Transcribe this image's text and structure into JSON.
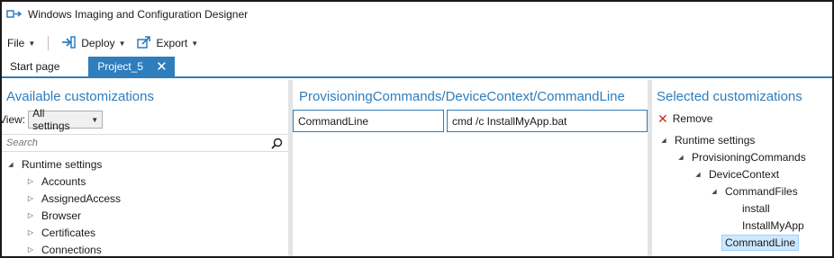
{
  "window": {
    "title": "Windows Imaging and Configuration Designer"
  },
  "menu": {
    "file": "File",
    "deploy": "Deploy",
    "export": "Export"
  },
  "tabs": [
    {
      "label": "Start page",
      "active": false
    },
    {
      "label": "Project_5",
      "active": true
    }
  ],
  "left": {
    "title": "Available customizations",
    "view_label": "View:",
    "view_value": "All settings",
    "search_placeholder": "Search",
    "tree_root": "Runtime settings",
    "tree_items": [
      "Accounts",
      "AssignedAccess",
      "Browser",
      "Certificates",
      "Connections"
    ]
  },
  "middle": {
    "title": "ProvisioningCommands/DeviceContext/CommandLine",
    "field_label": "CommandLine",
    "field_value": "cmd /c InstallMyApp.bat"
  },
  "right": {
    "title": "Selected customizations",
    "remove_label": "Remove",
    "tree": {
      "root": "Runtime settings",
      "provisioning": "ProvisioningCommands",
      "device_context": "DeviceContext",
      "command_files": "CommandFiles",
      "file1": "install",
      "file2": "InstallMyApp",
      "command_line": "CommandLine"
    }
  },
  "colors": {
    "accent": "#2e7dbd",
    "remove": "#c42b1c",
    "selection": "#cde8ff"
  },
  "icons": [
    "app-icon",
    "deploy-icon",
    "export-icon",
    "close-icon",
    "search-icon",
    "remove-icon"
  ]
}
